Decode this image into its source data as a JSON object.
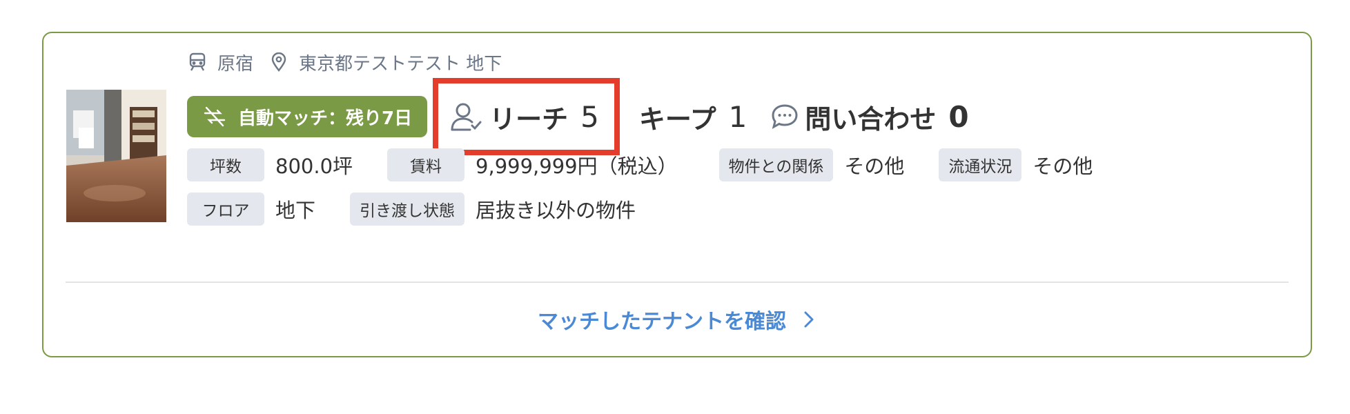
{
  "location": {
    "station": "原宿",
    "address": "東京都テストテスト 地下"
  },
  "status": {
    "auto_match_label": "自動マッチ：残り7日",
    "reach_label": "リーチ",
    "reach_count": "5",
    "keep_label": "キープ",
    "keep_count": "1",
    "inquiry_label": "問い合わせ",
    "inquiry_count": "0"
  },
  "attributes": {
    "row1": [
      {
        "label": "坪数",
        "value": "800.0坪"
      },
      {
        "label": "賃料",
        "value": "9,999,999円（税込）"
      },
      {
        "label": "物件との関係",
        "value": "その他"
      },
      {
        "label": "流通状況",
        "value": "その他"
      }
    ],
    "row2": [
      {
        "label": "フロア",
        "value": "地下"
      },
      {
        "label": "引き渡し状態",
        "value": "居抜き以外の物件"
      }
    ]
  },
  "footer": {
    "confirm_link": "マッチしたテナントを確認"
  },
  "colors": {
    "card_border": "#7a9a45",
    "badge_bg": "#7a9a45",
    "highlight": "#e53d2b",
    "link": "#4a89d6",
    "tag_bg": "#e4e8ee"
  },
  "icons": [
    "train-icon",
    "map-pin-icon",
    "no-sync-icon",
    "user-check-icon",
    "chat-bubble-icon",
    "chevron-right-icon"
  ]
}
